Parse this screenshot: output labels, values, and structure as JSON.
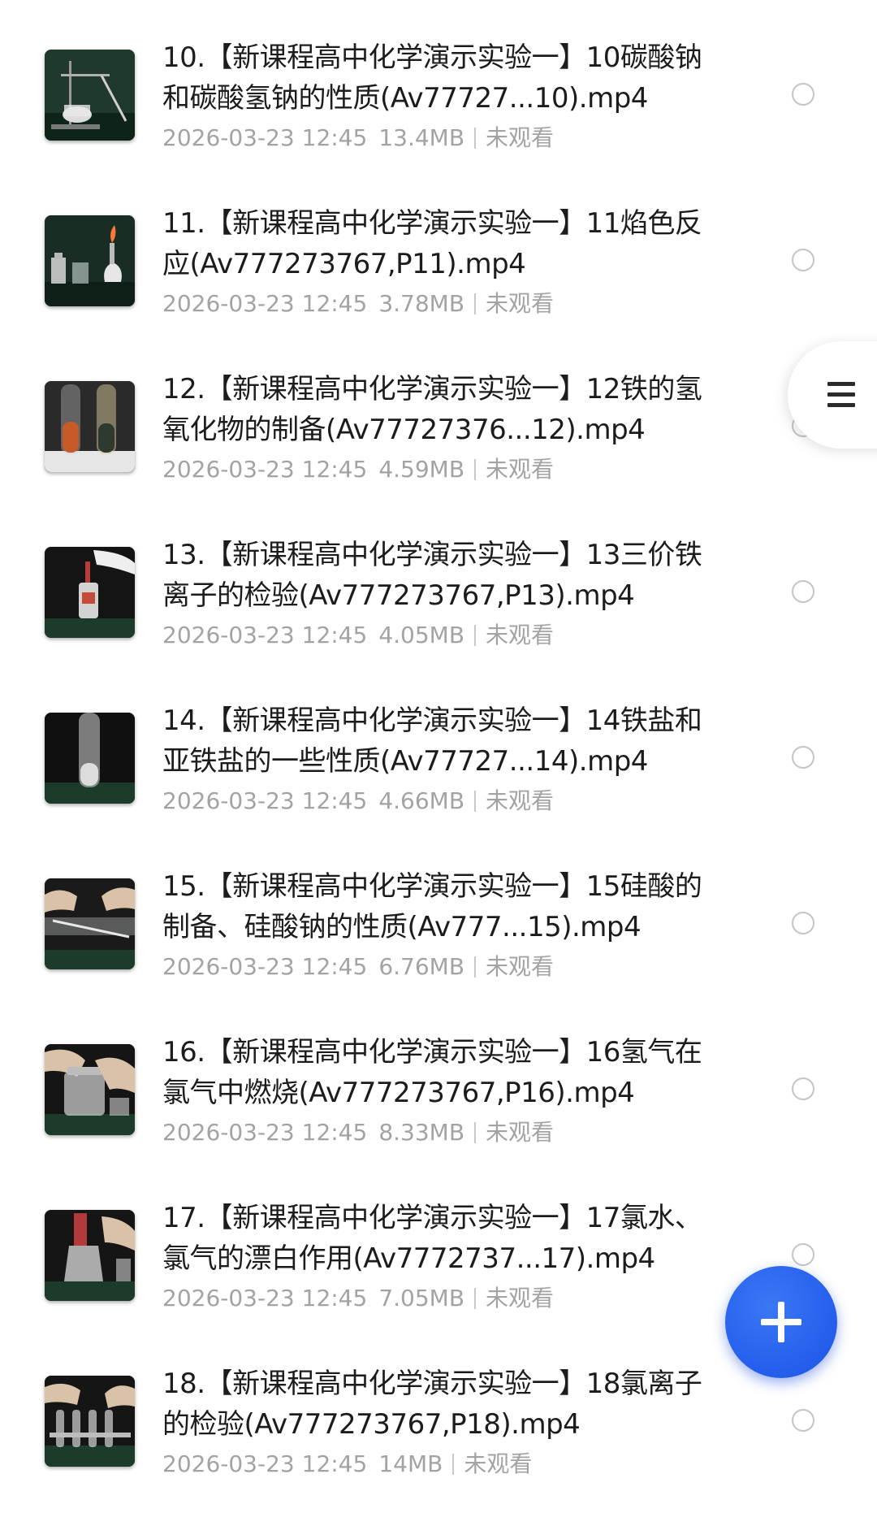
{
  "files": [
    {
      "title": "10.【新课程高中化学演示实验一】10碳酸钠和碳酸氢钠的性质(Av77727...10).mp4",
      "date": "2026-03-23 12:45",
      "size": "13.4MB",
      "status": "未观看",
      "thumb": "burner-stand-icon"
    },
    {
      "title": "11.【新课程高中化学演示实验一】11焰色反应(Av777273767,P11).mp4",
      "date": "2026-03-23 12:45",
      "size": "3.78MB",
      "status": "未观看",
      "thumb": "flame-test-icon"
    },
    {
      "title": "12.【新课程高中化学演示实验一】12铁的氢氧化物的制备(Av77727376...12).mp4",
      "date": "2026-03-23 12:45",
      "size": "4.59MB",
      "status": "未观看",
      "thumb": "test-tubes-icon"
    },
    {
      "title": "13.【新课程高中化学演示实验一】13三价铁离子的检验(Av777273767,P13).mp4",
      "date": "2026-03-23 12:45",
      "size": "4.05MB",
      "status": "未观看",
      "thumb": "dropper-bottle-icon"
    },
    {
      "title": "14.【新课程高中化学演示实验一】14铁盐和亚铁盐的一些性质(Av77727...14).mp4",
      "date": "2026-03-23 12:45",
      "size": "4.66MB",
      "status": "未观看",
      "thumb": "test-tube-icon"
    },
    {
      "title": "15.【新课程高中化学演示实验一】15硅酸的制备、硅酸钠的性质(Av777...15).mp4",
      "date": "2026-03-23 12:45",
      "size": "6.76MB",
      "status": "未观看",
      "thumb": "glass-rod-icon"
    },
    {
      "title": "16.【新课程高中化学演示实验一】16氢气在氯气中燃烧(Av777273767,P16).mp4",
      "date": "2026-03-23 12:45",
      "size": "8.33MB",
      "status": "未观看",
      "thumb": "gas-jar-icon"
    },
    {
      "title": "17.【新课程高中化学演示实验一】17氯水、氯气的漂白作用(Av7772737...17).mp4",
      "date": "2026-03-23 12:45",
      "size": "7.05MB",
      "status": "未观看",
      "thumb": "flask-dropper-icon"
    },
    {
      "title": "18.【新课程高中化学演示实验一】18氯离子的检验(Av777273767,P18).mp4",
      "date": "2026-03-23 12:45",
      "size": "14MB",
      "status": "未观看",
      "thumb": "tube-rack-icon"
    }
  ],
  "side_menu": {
    "icon": "menu-icon"
  },
  "fab": {
    "icon": "plus-icon"
  },
  "colors": {
    "title_text": "#1c1c1c",
    "meta_text": "#a3a3a3",
    "radio_border": "#c4c4c4",
    "fab_blue": "#2761ee"
  }
}
